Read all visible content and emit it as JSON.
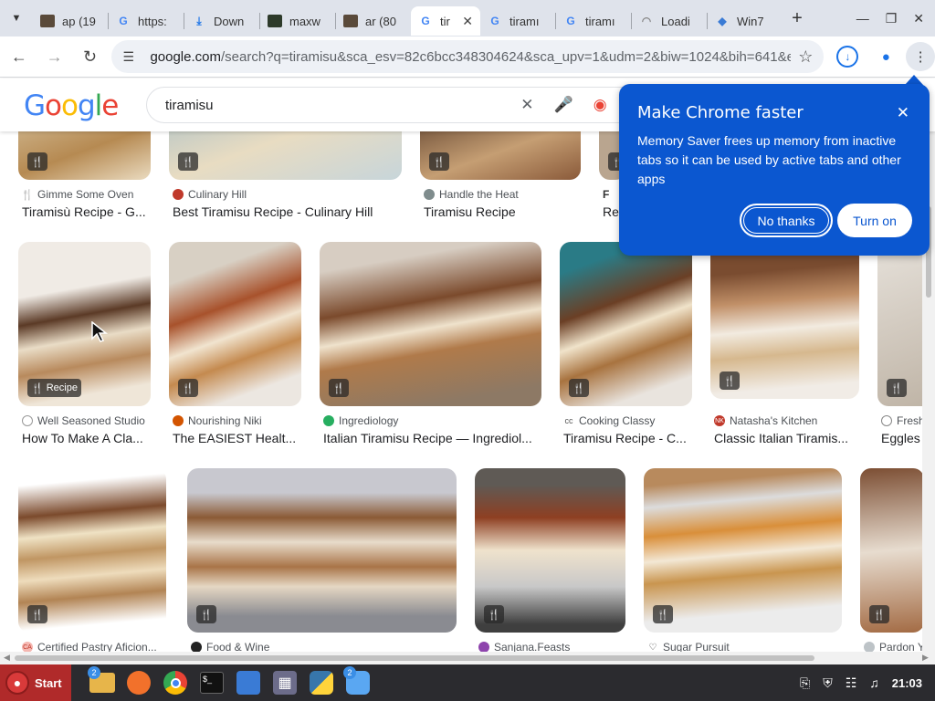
{
  "browser": {
    "tabs": [
      {
        "label": "ap (19",
        "favicon": "page-icon"
      },
      {
        "label": "https:",
        "favicon": "google-icon"
      },
      {
        "label": "Down",
        "favicon": "download-icon"
      },
      {
        "label": "maxw",
        "favicon": "page-icon"
      },
      {
        "label": "ar (80",
        "favicon": "page-icon"
      },
      {
        "label": "tir",
        "favicon": "google-icon",
        "active": true
      },
      {
        "label": "tiramı",
        "favicon": "google-icon"
      },
      {
        "label": "tiramı",
        "favicon": "google-icon"
      },
      {
        "label": "Loadi",
        "favicon": "loading-icon"
      },
      {
        "label": "Win7",
        "favicon": "page-icon"
      }
    ],
    "url_host": "google.com",
    "url_path": "/search?q=tiramisu&sca_esv=82c6bcc348304624&sca_upv=1&udm=2&biw=1024&bih=641&ei=2..."
  },
  "search": {
    "query": "tiramisu",
    "logo": "Google"
  },
  "popup": {
    "title": "Make Chrome faster",
    "body": "Memory Saver frees up memory from inactive tabs so it can be used by active tabs and other apps",
    "no_thanks": "No thanks",
    "turn_on": "Turn on",
    "accent": "#0b57d0"
  },
  "results": {
    "row1": [
      {
        "source": "Gimme Some Oven",
        "title": "Tiramisù Recipe - G..."
      },
      {
        "source": "Culinary Hill",
        "title": "Best Tiramisu Recipe - Culinary Hill"
      },
      {
        "source": "Handle the Heat",
        "title": "Tiramisu Recipe"
      },
      {
        "source": "F",
        "title": "Re"
      }
    ],
    "row2": [
      {
        "source": "Well Seasoned Studio",
        "title": "How To Make A Cla...",
        "badge": "Recipe"
      },
      {
        "source": "Nourishing Niki",
        "title": "The EASIEST Healt..."
      },
      {
        "source": "Ingrediology",
        "title": "Italian Tiramisu Recipe — Ingrediol..."
      },
      {
        "source": "Cooking Classy",
        "title": "Tiramisu Recipe - C..."
      },
      {
        "source": "Natasha's Kitchen",
        "title": "Classic Italian Tiramis..."
      },
      {
        "source": "Fresh",
        "title": "Eggles"
      }
    ],
    "row3": [
      {
        "source": "Certified Pastry Aficion..."
      },
      {
        "source": "Food & Wine"
      },
      {
        "source": "Sanjana.Feasts"
      },
      {
        "source": "Sugar Pursuit"
      },
      {
        "source": "Pardon Y"
      }
    ]
  },
  "taskbar": {
    "start": "Start",
    "clock": "21:03",
    "badge_files": "2",
    "badge_finder": "2"
  }
}
